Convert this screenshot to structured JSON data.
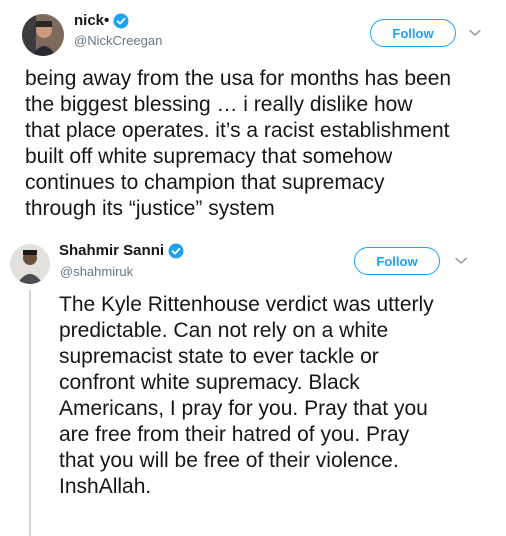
{
  "tweets": [
    {
      "display_name": "nick•",
      "handle": "@NickCreegan",
      "verified": true,
      "follow_label": "Follow",
      "avatar_icon": "user-avatar-icon",
      "text": "being away from the usa for months has been\nthe biggest blessing … i really dislike how\nthat place operates. it’s a racist establishment\nbuilt off white supremacy that somehow\ncontinues to champion that supremacy\nthrough its “justice” system"
    },
    {
      "display_name": "Shahmir Sanni",
      "handle": "@shahmiruk",
      "verified": true,
      "follow_label": "Follow",
      "avatar_icon": "user-avatar-icon",
      "text": "The Kyle Rittenhouse verdict was utterly\npredictable. Can not rely on a white\nsupremacist state to ever tackle or\nconfront white supremacy. Black\nAmericans, I pray for you. Pray that you\nare free from their hatred of you. Pray\nthat you will be free of their violence.\nInshAllah."
    }
  ],
  "colors": {
    "accent": "#1da1f2",
    "text": "#14171a",
    "secondary_text": "#657786",
    "thread_line": "#ccd6dd"
  },
  "icons": {
    "verified": "verified-badge-icon",
    "caret": "chevron-down-icon"
  }
}
